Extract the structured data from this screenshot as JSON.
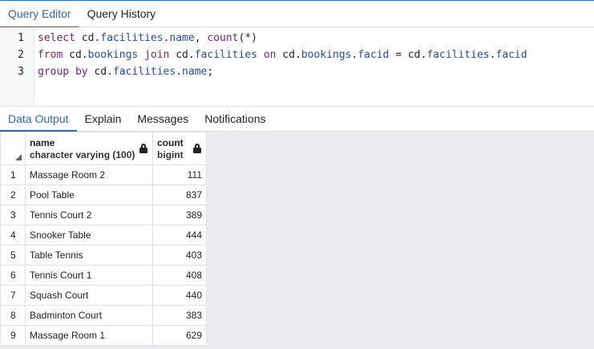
{
  "editor_tabs": [
    "Query Editor",
    "Query History"
  ],
  "editor": {
    "line_numbers": [
      "1",
      "2",
      "3"
    ],
    "lines": [
      [
        {
          "t": "select",
          "c": "kw"
        },
        {
          "t": " cd",
          "c": "plain"
        },
        {
          "t": ".",
          "c": "plain"
        },
        {
          "t": "facilities",
          "c": "id"
        },
        {
          "t": ".",
          "c": "plain"
        },
        {
          "t": "name",
          "c": "id"
        },
        {
          "t": ", ",
          "c": "plain"
        },
        {
          "t": "count",
          "c": "fn"
        },
        {
          "t": "(*)",
          "c": "plain"
        }
      ],
      [
        {
          "t": "from",
          "c": "kw"
        },
        {
          "t": " cd",
          "c": "plain"
        },
        {
          "t": ".",
          "c": "plain"
        },
        {
          "t": "bookings",
          "c": "id"
        },
        {
          "t": " ",
          "c": "plain"
        },
        {
          "t": "join",
          "c": "kw"
        },
        {
          "t": " cd",
          "c": "plain"
        },
        {
          "t": ".",
          "c": "plain"
        },
        {
          "t": "facilities",
          "c": "id"
        },
        {
          "t": " ",
          "c": "plain"
        },
        {
          "t": "on",
          "c": "kw"
        },
        {
          "t": " cd",
          "c": "plain"
        },
        {
          "t": ".",
          "c": "plain"
        },
        {
          "t": "bookings",
          "c": "id"
        },
        {
          "t": ".",
          "c": "plain"
        },
        {
          "t": "facid",
          "c": "id"
        },
        {
          "t": " = cd",
          "c": "plain"
        },
        {
          "t": ".",
          "c": "plain"
        },
        {
          "t": "facilities",
          "c": "id"
        },
        {
          "t": ".",
          "c": "plain"
        },
        {
          "t": "facid",
          "c": "id"
        }
      ],
      [
        {
          "t": "group by",
          "c": "kw"
        },
        {
          "t": " cd",
          "c": "plain"
        },
        {
          "t": ".",
          "c": "plain"
        },
        {
          "t": "facilities",
          "c": "id"
        },
        {
          "t": ".",
          "c": "plain"
        },
        {
          "t": "name",
          "c": "id"
        },
        {
          "t": ";",
          "c": "plain"
        }
      ]
    ]
  },
  "output_tabs": [
    "Data Output",
    "Explain",
    "Messages",
    "Notifications"
  ],
  "grid": {
    "columns": [
      {
        "name": "name",
        "type": "character varying (100)"
      },
      {
        "name": "count",
        "type": "bigint"
      }
    ],
    "rows": [
      {
        "n": "1",
        "name": "Massage Room 2",
        "count": "111"
      },
      {
        "n": "2",
        "name": "Pool Table",
        "count": "837"
      },
      {
        "n": "3",
        "name": "Tennis Court 2",
        "count": "389"
      },
      {
        "n": "4",
        "name": "Snooker Table",
        "count": "444"
      },
      {
        "n": "5",
        "name": "Table Tennis",
        "count": "403"
      },
      {
        "n": "6",
        "name": "Tennis Court 1",
        "count": "408"
      },
      {
        "n": "7",
        "name": "Squash Court",
        "count": "440"
      },
      {
        "n": "8",
        "name": "Badminton Court",
        "count": "383"
      },
      {
        "n": "9",
        "name": "Massage Room 1",
        "count": "629"
      }
    ]
  }
}
